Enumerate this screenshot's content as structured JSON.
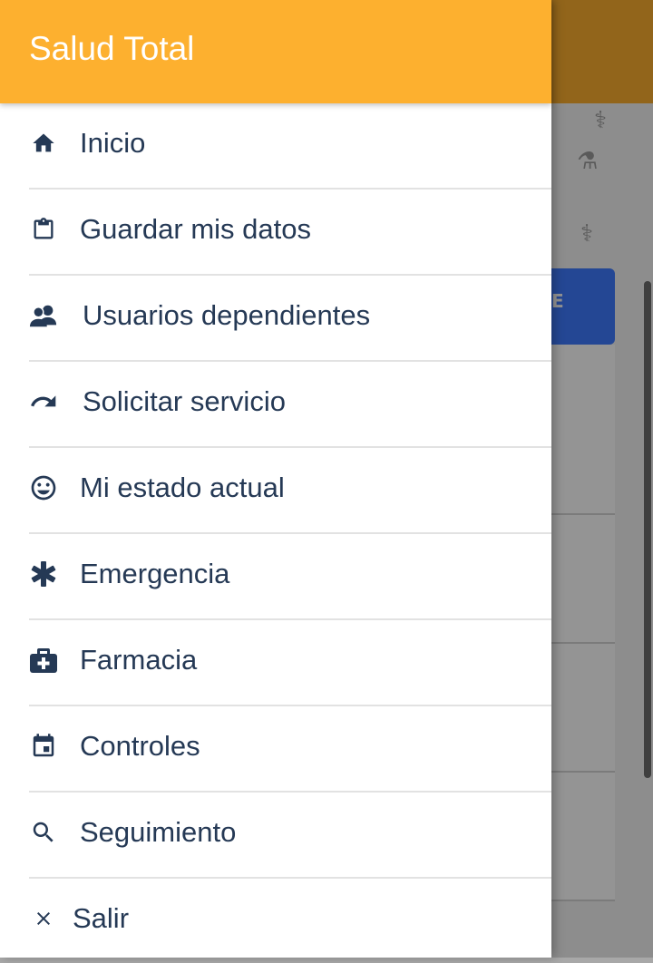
{
  "drawer": {
    "title": "Salud Total",
    "items": [
      {
        "label": "Inicio",
        "icon": "home-icon"
      },
      {
        "label": "Guardar mis datos",
        "icon": "clipboard-icon"
      },
      {
        "label": "Usuarios dependientes",
        "icon": "users-icon"
      },
      {
        "label": "Solicitar servicio",
        "icon": "redo-arrow-icon"
      },
      {
        "label": "Mi estado actual",
        "icon": "smiley-icon"
      },
      {
        "label": "Emergencia",
        "icon": "asterisk-icon"
      },
      {
        "label": "Farmacia",
        "icon": "medical-kit-icon"
      },
      {
        "label": "Controles",
        "icon": "calendar-icon"
      },
      {
        "label": "Seguimiento",
        "icon": "search-icon"
      },
      {
        "label": "Salir",
        "icon": "close-icon"
      }
    ]
  },
  "background": {
    "button_label_fragment": "E"
  },
  "colors": {
    "header": "#fdb02f",
    "text": "#253955",
    "accent_button": "#3f7bff"
  }
}
